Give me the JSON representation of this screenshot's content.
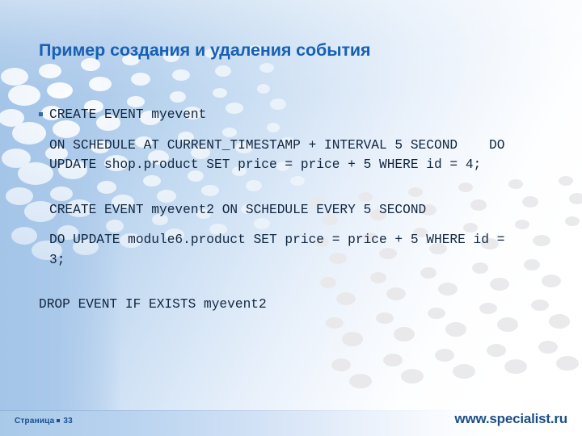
{
  "slide": {
    "title": "Пример создания и удаления события",
    "accent_color": "#1860b4",
    "text_color": "#11263f",
    "bullet_color": "#2e6ca4"
  },
  "content": {
    "blocks": [
      {
        "id": "block-1",
        "bulleted": true,
        "text": "CREATE EVENT myevent"
      },
      {
        "id": "block-2",
        "bulleted": false,
        "text": "ON SCHEDULE AT CURRENT_TIMESTAMP + INTERVAL 5 SECOND    DO     UPDATE shop.product SET price = price + 5 WHERE id = 4;"
      },
      {
        "id": "block-3",
        "bulleted": false,
        "text": "CREATE EVENT myevent2 ON SCHEDULE EVERY 5 SECOND"
      },
      {
        "id": "block-4",
        "bulleted": false,
        "text": "DO UPDATE module6.product SET price = price + 5 WHERE id = 3;"
      },
      {
        "id": "block-5",
        "bulleted": false,
        "text": "DROP EVENT IF EXISTS myevent2"
      }
    ]
  },
  "footer": {
    "page_label": "Страница",
    "page_number": "33",
    "site_url": "www.specialist.ru"
  }
}
